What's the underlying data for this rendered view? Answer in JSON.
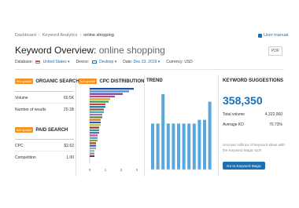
{
  "breadcrumb": [
    "Dashboard",
    "Keyword Analytics",
    "online shopping"
  ],
  "user_manual": "User manual",
  "title": {
    "prefix": "Keyword Overview:",
    "keyword": "online shopping"
  },
  "pdf_label": "PDF",
  "filters": {
    "database_label": "Database:",
    "database_value": "United States",
    "device_label": "Device:",
    "device_value": "Desktop",
    "date_label": "Date:",
    "date_value": "Dec 23, 2019",
    "currency_label": "Currency:",
    "currency_value": "USD"
  },
  "organic": {
    "badge": "live update",
    "title": "ORGANIC SEARCH",
    "rows": [
      {
        "label": "Volume",
        "value": "60.5K"
      },
      {
        "label": "Number of results",
        "value": "20.1B"
      }
    ]
  },
  "paid": {
    "badge": "live update",
    "title": "PAID SEARCH",
    "rows": [
      {
        "label": "CPC",
        "value": "$2.62"
      },
      {
        "label": "Competition",
        "value": "1.00"
      }
    ]
  },
  "cpc": {
    "badge": "live update",
    "title": "CPC DISTRIBUTION"
  },
  "trend": {
    "title": "TREND"
  },
  "suggestions": {
    "title": "KEYWORD SUGGESTIONS",
    "total": "358,350",
    "rows": [
      {
        "label": "Total volume",
        "value": "4,322,060"
      },
      {
        "label": "Average KD",
        "value": "70.73%"
      }
    ],
    "note": "Uncover millions of keyword ideas with the Keyword Magic tool!",
    "button": "Go to Keyword Magic"
  },
  "colors": {
    "accent": "#1a6fb5",
    "badge": "#f7931e"
  },
  "chart_data": [
    {
      "type": "bar",
      "orientation": "horizontal",
      "title": "CPC DISTRIBUTION",
      "categories": [
        "1",
        "2",
        "3",
        "4",
        "5",
        "6",
        "7",
        "8",
        "9",
        "10",
        "11",
        "12",
        "13",
        "14",
        "15",
        "16",
        "17",
        "18",
        "19",
        "20",
        "21",
        "22",
        "23",
        "24",
        "25",
        "26",
        "27"
      ],
      "values": [
        2.8,
        2.5,
        2.1,
        1.6,
        1.3,
        1.2,
        1.0,
        1.0,
        0.9,
        0.9,
        0.8,
        0.8,
        0.7,
        0.7,
        0.7,
        0.6,
        0.6,
        0.6,
        0.5,
        0.5,
        0.5,
        0.4,
        0.4,
        0.4,
        0.3,
        0.3,
        0.3
      ],
      "colors": [
        "#1f4fa0",
        "#4a8ad6",
        "#6b3fa0",
        "#c03c8c",
        "#e0a020",
        "#2e9e4a",
        "#d04030",
        "#1a6fb5",
        "#8c5a2b",
        "#3aa8b8",
        "#b06ad0",
        "#5a8a2a",
        "#e07020",
        "#2a5ab0",
        "#c0c030",
        "#9a3040",
        "#30a080",
        "#6060c0",
        "#d0508a",
        "#4a9ad6",
        "#8aa030",
        "#b04020",
        "#3060a0",
        "#a0a0a0",
        "#60c0e0",
        "#c08040",
        "#503090"
      ],
      "xticks": [
        "0",
        "1",
        "2",
        "3"
      ],
      "xlim": [
        0,
        3
      ]
    },
    {
      "type": "bar",
      "title": "TREND",
      "values": [
        0.61,
        0.61,
        1.0,
        0.61,
        0.61,
        0.61,
        0.61,
        0.61,
        0.61,
        0.66,
        0.66,
        0.9
      ],
      "ylim": [
        0,
        1
      ]
    }
  ]
}
